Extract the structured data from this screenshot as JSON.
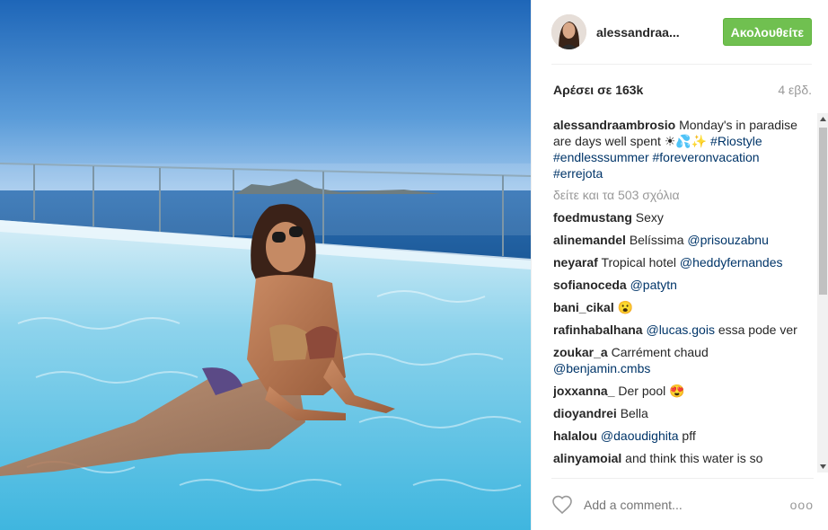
{
  "post": {
    "username": "alessandraa...",
    "follow_label": "Ακολουθείτε",
    "likes": "Αρέσει σε 163k",
    "age": "4 εβδ.",
    "caption": {
      "user": "alessandraambrosio",
      "text": "Monday's in paradise are days well spent ☀💦✨",
      "tags": "#Riostyle #endlesssummer #foreveronvacation #errejota"
    },
    "view_all": "δείτε και τα 503 σχόλια",
    "comments": [
      {
        "user": "foedmustang",
        "text": "Sexy",
        "mention": ""
      },
      {
        "user": "alinemandel",
        "text": "Belíssima",
        "mention": "@prisouzabnu"
      },
      {
        "user": "neyaraf",
        "text": "Tropical hotel",
        "mention": "@heddyfernandes"
      },
      {
        "user": "sofianoceda",
        "text": "",
        "mention": "@patytn"
      },
      {
        "user": "bani_cikal",
        "text": "😮",
        "mention": ""
      },
      {
        "user": "rafinhabalhana",
        "text": "essa pode ver",
        "mention": "@lucas.gois"
      },
      {
        "user": "zoukar_a",
        "text": "Carrément chaud",
        "mention": "@benjamin.cmbs"
      },
      {
        "user": "joxxanna_",
        "text": "Der pool 😍",
        "mention": ""
      },
      {
        "user": "dioyandrei",
        "text": "Bella",
        "mention": ""
      },
      {
        "user": "halalou",
        "text": "pff",
        "mention": "@daoudighita"
      },
      {
        "user": "alinyamoial",
        "text": "and think this water is so",
        "mention": ""
      }
    ],
    "add_comment_placeholder": "Add a comment...",
    "more_options": "ooo"
  },
  "colors": {
    "follow_green": "#70c050",
    "link_blue": "#003569",
    "muted_gray": "#999999"
  },
  "icons": [
    "heart-icon",
    "more-options-icon",
    "scroll-up-icon",
    "scroll-down-icon"
  ]
}
